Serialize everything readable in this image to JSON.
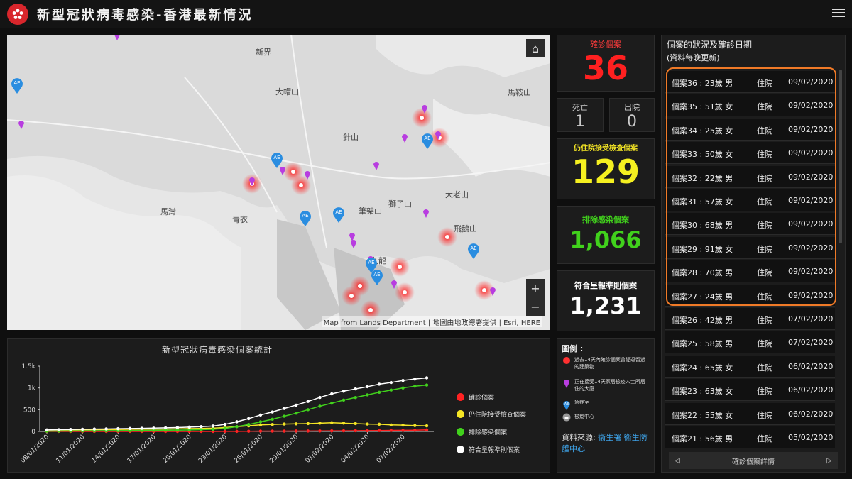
{
  "header": {
    "title": "新型冠狀病毒感染-香港最新情況"
  },
  "map": {
    "attribution": "Map from Lands Department | 地圖由地政總署提供 | Esri, HERE",
    "places": [
      "新界",
      "大帽山",
      "馬鞍山",
      "針山",
      "大老山",
      "獅子山",
      "筆架山",
      "飛鵝山",
      "馬灣",
      "青衣",
      "九龍"
    ],
    "zoom_in": "+",
    "zoom_out": "−",
    "badge": "AE"
  },
  "stats": {
    "confirmed_label": "確診個案",
    "confirmed": "36",
    "deaths_label": "死亡",
    "deaths": "1",
    "discharged_label": "出院",
    "discharged": "0",
    "hospital_label": "仍住院接受檢查個案",
    "hospital": "129",
    "excluded_label": "排除感染個案",
    "excluded": "1,066",
    "reported_label": "符合呈報準則個案",
    "reported": "1,231"
  },
  "chart": {
    "title": "新型冠狀病毒感染個案統計"
  },
  "chart_data": {
    "type": "line",
    "title": "新型冠狀病毒感染個案統計",
    "x": [
      "08/01/2020",
      "09/01/2020",
      "10/01/2020",
      "11/01/2020",
      "12/01/2020",
      "13/01/2020",
      "14/01/2020",
      "15/01/2020",
      "16/01/2020",
      "17/01/2020",
      "18/01/2020",
      "19/01/2020",
      "20/01/2020",
      "21/01/2020",
      "22/01/2020",
      "23/01/2020",
      "24/01/2020",
      "25/01/2020",
      "26/01/2020",
      "27/01/2020",
      "28/01/2020",
      "29/01/2020",
      "30/01/2020",
      "31/01/2020",
      "01/02/2020",
      "02/02/2020",
      "03/02/2020",
      "04/02/2020",
      "05/02/2020",
      "06/02/2020",
      "07/02/2020",
      "08/02/2020",
      "09/02/2020"
    ],
    "xticks": [
      "08/01/2020",
      "11/01/2020",
      "14/01/2020",
      "17/01/2020",
      "20/01/2020",
      "23/01/2020",
      "26/01/2020",
      "29/01/2020",
      "01/02/2020",
      "04/02/2020",
      "07/02/2020"
    ],
    "yticks": [
      "0",
      "500",
      "1k",
      "1.5k"
    ],
    "ylim": [
      0,
      1500
    ],
    "series": [
      {
        "name": "確診個案",
        "color": "#ff2222",
        "values": [
          0,
          0,
          0,
          0,
          0,
          0,
          0,
          0,
          0,
          0,
          0,
          0,
          0,
          0,
          0,
          2,
          2,
          5,
          8,
          8,
          8,
          10,
          10,
          12,
          14,
          15,
          17,
          18,
          21,
          24,
          26,
          29,
          36
        ]
      },
      {
        "name": "仍住院接受檢查個案",
        "color": "#f5e625",
        "values": [
          30,
          32,
          35,
          38,
          40,
          42,
          45,
          48,
          50,
          52,
          55,
          60,
          65,
          70,
          75,
          90,
          110,
          130,
          150,
          160,
          170,
          175,
          180,
          190,
          200,
          190,
          180,
          170,
          165,
          150,
          145,
          135,
          129
        ]
      },
      {
        "name": "排除感染個案",
        "color": "#41d11c",
        "values": [
          5,
          8,
          10,
          12,
          14,
          16,
          18,
          20,
          22,
          25,
          28,
          30,
          35,
          40,
          50,
          70,
          110,
          160,
          220,
          280,
          350,
          420,
          500,
          580,
          650,
          720,
          780,
          840,
          900,
          950,
          1000,
          1040,
          1066
        ]
      },
      {
        "name": "符合呈報準則個案",
        "color": "#ffffff",
        "values": [
          35,
          40,
          45,
          50,
          55,
          58,
          63,
          68,
          72,
          77,
          83,
          90,
          100,
          110,
          125,
          162,
          222,
          295,
          378,
          448,
          528,
          605,
          690,
          782,
          864,
          925,
          977,
          1028,
          1086,
          1124,
          1171,
          1204,
          1231
        ]
      }
    ]
  },
  "legend": {
    "title": "圖例 :",
    "items": [
      "過去14天內確診個案曾經逗留過的建築物",
      "正在接受14天家居檢疫人士所居住的大廈",
      "急症室",
      "檢疫中心"
    ],
    "source_label": "資料來源:",
    "source_link": "衞生署 衞生防護中心"
  },
  "cases": {
    "title": "個案的狀況及確診日期",
    "subtitle": "(資料每晚更新)",
    "status": "住院",
    "rows": [
      {
        "id": "個案36 : 23歲 男",
        "date": "09/02/2020"
      },
      {
        "id": "個案35 : 51歲 女",
        "date": "09/02/2020"
      },
      {
        "id": "個案34 : 25歲 女",
        "date": "09/02/2020"
      },
      {
        "id": "個案33 : 50歲 女",
        "date": "09/02/2020"
      },
      {
        "id": "個案32 : 22歲 男",
        "date": "09/02/2020"
      },
      {
        "id": "個案31 : 57歲 女",
        "date": "09/02/2020"
      },
      {
        "id": "個案30 : 68歲 男",
        "date": "09/02/2020"
      },
      {
        "id": "個案29 : 91歲 女",
        "date": "09/02/2020"
      },
      {
        "id": "個案28 : 70歲 男",
        "date": "09/02/2020"
      },
      {
        "id": "個案27 : 24歲 男",
        "date": "09/02/2020"
      },
      {
        "id": "個案26 : 42歲 男",
        "date": "07/02/2020"
      },
      {
        "id": "個案25 : 58歲 男",
        "date": "07/02/2020"
      },
      {
        "id": "個案24 : 65歲 女",
        "date": "06/02/2020"
      },
      {
        "id": "個案23 : 63歲 女",
        "date": "06/02/2020"
      },
      {
        "id": "個案22 : 55歲 女",
        "date": "06/02/2020"
      },
      {
        "id": "個案21 : 56歲 男",
        "date": "05/02/2020"
      }
    ],
    "pager_label": "確診個案詳情",
    "prev": "◁",
    "next": "▷"
  }
}
